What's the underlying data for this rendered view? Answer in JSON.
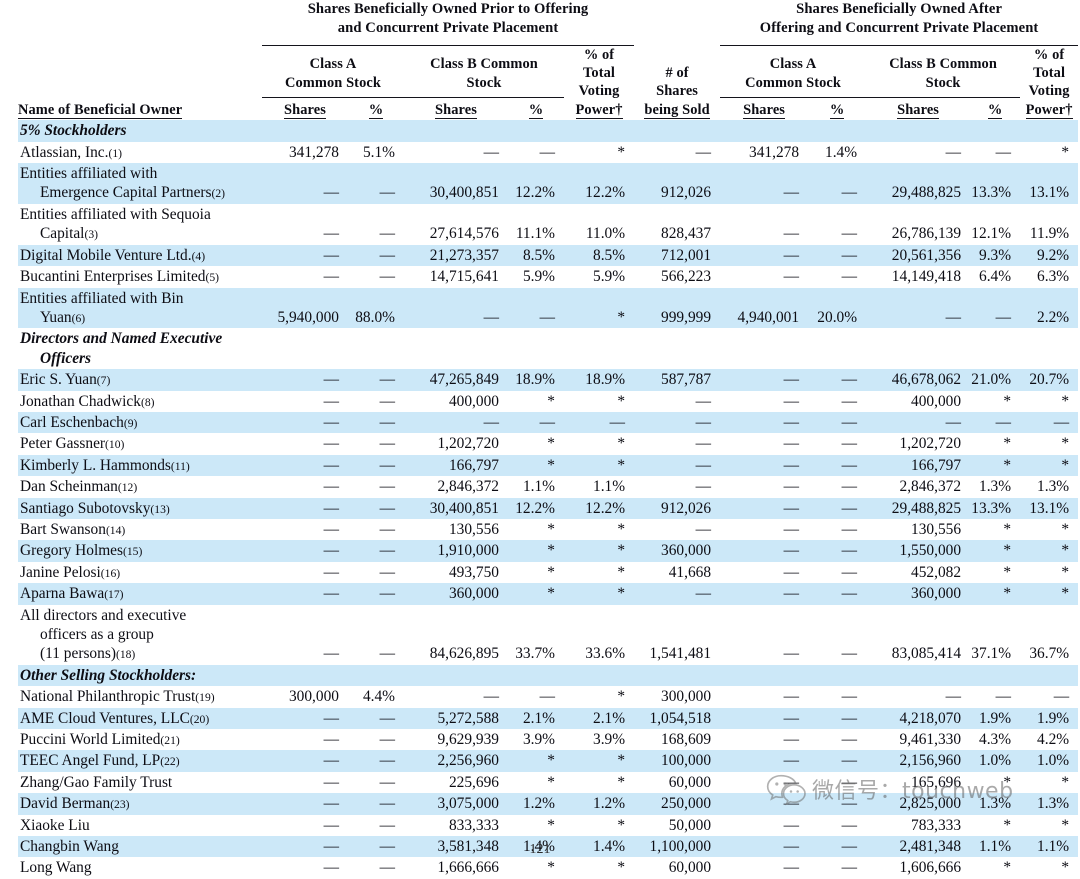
{
  "document": {
    "page_number": "121",
    "watermark_text": "微信号：touchweb",
    "watermark_icon": "wechat-bubble-icon",
    "stripe_color": "#cce8f8",
    "text_color": "#0d0d14"
  },
  "header": {
    "name_column": "Name of Beneficial Owner",
    "group_prior": "Shares Beneficially Owned Prior to Offering and Concurrent Private Placement",
    "group_prior_line1": "Shares Beneficially Owned Prior to Offering",
    "group_prior_line2": "and Concurrent Private Placement",
    "group_after": "Shares Beneficially Owned After Offering and Concurrent Private Placement",
    "group_after_line1": "Shares Beneficially Owned After",
    "group_after_line2": "Offering and Concurrent Private Placement",
    "class_a_line1": "Class A",
    "class_a_line2": "Common Stock",
    "class_b_line1": "Class B Common",
    "class_b_line2": "Stock",
    "shares": "Shares",
    "percent": "%",
    "voting_power_l1": "% of",
    "voting_power_l2": "Total",
    "voting_power_l3": "Voting",
    "voting_power_l4": "Power†",
    "shares_sold_l1": "# of",
    "shares_sold_l2": "Shares",
    "shares_sold_l3": "being Sold"
  },
  "sections": {
    "five_percent": "5% Stockholders",
    "directors": "Directors and Named Executive Officers",
    "directors_line1": "Directors and Named Executive",
    "directors_line2": "Officers",
    "other": "Other Selling Stockholders:"
  },
  "rows": [
    {
      "type": "section",
      "label": "5% Stockholders",
      "shaded": true
    },
    {
      "type": "data",
      "shaded": false,
      "indent": 0,
      "name": "Atlassian, Inc.",
      "note": "(1)",
      "a_shares": "341,278",
      "a_pct": "5.1%",
      "b_shares": "—",
      "b_pct": "—",
      "vp": "*",
      "sold": "—",
      "a2_shares": "341,278",
      "a2_pct": "1.4%",
      "b2_shares": "—",
      "b2_pct": "—",
      "vp2": "*"
    },
    {
      "type": "data",
      "shaded": true,
      "indent": 1,
      "name_line1": "Entities affiliated with",
      "name_line2": "Emergence Capital Partners",
      "note": "(2)",
      "a_shares": "—",
      "a_pct": "—",
      "b_shares": "30,400,851",
      "b_pct": "12.2%",
      "vp": "12.2%",
      "sold": "912,026",
      "a2_shares": "—",
      "a2_pct": "—",
      "b2_shares": "29,488,825",
      "b2_pct": "13.3%",
      "vp2": "13.1%"
    },
    {
      "type": "data",
      "shaded": false,
      "indent": 1,
      "name_line1": "Entities affiliated with Sequoia",
      "name_line2": "Capital",
      "note": "(3)",
      "a_shares": "—",
      "a_pct": "—",
      "b_shares": "27,614,576",
      "b_pct": "11.1%",
      "vp": "11.0%",
      "sold": "828,437",
      "a2_shares": "—",
      "a2_pct": "—",
      "b2_shares": "26,786,139",
      "b2_pct": "12.1%",
      "vp2": "11.9%"
    },
    {
      "type": "data",
      "shaded": true,
      "indent": 0,
      "name": "Digital Mobile Venture Ltd.",
      "note": "(4)",
      "a_shares": "—",
      "a_pct": "—",
      "b_shares": "21,273,357",
      "b_pct": "8.5%",
      "vp": "8.5%",
      "sold": "712,001",
      "a2_shares": "—",
      "a2_pct": "—",
      "b2_shares": "20,561,356",
      "b2_pct": "9.3%",
      "vp2": "9.2%"
    },
    {
      "type": "data",
      "shaded": false,
      "indent": 0,
      "name": "Bucantini Enterprises Limited",
      "note": "(5)",
      "a_shares": "—",
      "a_pct": "—",
      "b_shares": "14,715,641",
      "b_pct": "5.9%",
      "vp": "5.9%",
      "sold": "566,223",
      "a2_shares": "—",
      "a2_pct": "—",
      "b2_shares": "14,149,418",
      "b2_pct": "6.4%",
      "vp2": "6.3%"
    },
    {
      "type": "data",
      "shaded": true,
      "indent": 1,
      "name_line1": "Entities affiliated with Bin",
      "name_line2": "Yuan",
      "note": "(6)",
      "a_shares": "5,940,000",
      "a_pct": "88.0%",
      "b_shares": "—",
      "b_pct": "—",
      "vp": "*",
      "sold": "999,999",
      "a2_shares": "4,940,001",
      "a2_pct": "20.0%",
      "b2_shares": "—",
      "b2_pct": "—",
      "vp2": "2.2%"
    },
    {
      "type": "section2",
      "label_line1": "Directors and Named Executive",
      "label_line2": "Officers",
      "shaded": false
    },
    {
      "type": "data",
      "shaded": true,
      "indent": 0,
      "name": "Eric S. Yuan",
      "note": "(7)",
      "a_shares": "—",
      "a_pct": "—",
      "b_shares": "47,265,849",
      "b_pct": "18.9%",
      "vp": "18.9%",
      "sold": "587,787",
      "a2_shares": "—",
      "a2_pct": "—",
      "b2_shares": "46,678,062",
      "b2_pct": "21.0%",
      "vp2": "20.7%"
    },
    {
      "type": "data",
      "shaded": false,
      "indent": 0,
      "name": "Jonathan Chadwick",
      "note": "(8)",
      "a_shares": "—",
      "a_pct": "—",
      "b_shares": "400,000",
      "b_pct": "*",
      "vp": "*",
      "sold": "—",
      "a2_shares": "—",
      "a2_pct": "—",
      "b2_shares": "400,000",
      "b2_pct": "*",
      "vp2": "*"
    },
    {
      "type": "data",
      "shaded": true,
      "indent": 0,
      "name": "Carl Eschenbach",
      "note": "(9)",
      "a_shares": "—",
      "a_pct": "—",
      "b_shares": "—",
      "b_pct": "—",
      "vp": "—",
      "sold": "—",
      "a2_shares": "—",
      "a2_pct": "—",
      "b2_shares": "—",
      "b2_pct": "—",
      "vp2": "—"
    },
    {
      "type": "data",
      "shaded": false,
      "indent": 0,
      "name": "Peter Gassner",
      "note": "(10)",
      "a_shares": "—",
      "a_pct": "—",
      "b_shares": "1,202,720",
      "b_pct": "*",
      "vp": "*",
      "sold": "—",
      "a2_shares": "—",
      "a2_pct": "—",
      "b2_shares": "1,202,720",
      "b2_pct": "*",
      "vp2": "*"
    },
    {
      "type": "data",
      "shaded": true,
      "indent": 0,
      "name": "Kimberly L. Hammonds",
      "note": "(11)",
      "a_shares": "—",
      "a_pct": "—",
      "b_shares": "166,797",
      "b_pct": "*",
      "vp": "*",
      "sold": "—",
      "a2_shares": "—",
      "a2_pct": "—",
      "b2_shares": "166,797",
      "b2_pct": "*",
      "vp2": "*"
    },
    {
      "type": "data",
      "shaded": false,
      "indent": 0,
      "name": "Dan Scheinman",
      "note": "(12)",
      "a_shares": "—",
      "a_pct": "—",
      "b_shares": "2,846,372",
      "b_pct": "1.1%",
      "vp": "1.1%",
      "sold": "—",
      "a2_shares": "—",
      "a2_pct": "—",
      "b2_shares": "2,846,372",
      "b2_pct": "1.3%",
      "vp2": "1.3%"
    },
    {
      "type": "data",
      "shaded": true,
      "indent": 0,
      "name": "Santiago Subotovsky",
      "note": "(13)",
      "a_shares": "—",
      "a_pct": "—",
      "b_shares": "30,400,851",
      "b_pct": "12.2%",
      "vp": "12.2%",
      "sold": "912,026",
      "a2_shares": "—",
      "a2_pct": "—",
      "b2_shares": "29,488,825",
      "b2_pct": "13.3%",
      "vp2": "13.1%"
    },
    {
      "type": "data",
      "shaded": false,
      "indent": 0,
      "name": "Bart Swanson",
      "note": "(14)",
      "a_shares": "—",
      "a_pct": "—",
      "b_shares": "130,556",
      "b_pct": "*",
      "vp": "*",
      "sold": "—",
      "a2_shares": "—",
      "a2_pct": "—",
      "b2_shares": "130,556",
      "b2_pct": "*",
      "vp2": "*"
    },
    {
      "type": "data",
      "shaded": true,
      "indent": 0,
      "name": "Gregory Holmes",
      "note": "(15)",
      "a_shares": "—",
      "a_pct": "—",
      "b_shares": "1,910,000",
      "b_pct": "*",
      "vp": "*",
      "sold": "360,000",
      "a2_shares": "—",
      "a2_pct": "—",
      "b2_shares": "1,550,000",
      "b2_pct": "*",
      "vp2": "*"
    },
    {
      "type": "data",
      "shaded": false,
      "indent": 0,
      "name": "Janine Pelosi",
      "note": "(16)",
      "a_shares": "—",
      "a_pct": "—",
      "b_shares": "493,750",
      "b_pct": "*",
      "vp": "*",
      "sold": "41,668",
      "a2_shares": "—",
      "a2_pct": "—",
      "b2_shares": "452,082",
      "b2_pct": "*",
      "vp2": "*"
    },
    {
      "type": "data",
      "shaded": true,
      "indent": 0,
      "name": "Aparna Bawa",
      "note": "(17)",
      "a_shares": "—",
      "a_pct": "—",
      "b_shares": "360,000",
      "b_pct": "*",
      "vp": "*",
      "sold": "—",
      "a2_shares": "—",
      "a2_pct": "—",
      "b2_shares": "360,000",
      "b2_pct": "*",
      "vp2": "*"
    },
    {
      "type": "data3",
      "shaded": false,
      "indent": 2,
      "name_line1": "All directors and executive",
      "name_line2": "officers as a group",
      "name_line3": "(11 persons)",
      "note": "(18)",
      "a_shares": "—",
      "a_pct": "—",
      "b_shares": "84,626,895",
      "b_pct": "33.7%",
      "vp": "33.6%",
      "sold": "1,541,481",
      "a2_shares": "—",
      "a2_pct": "—",
      "b2_shares": "83,085,414",
      "b2_pct": "37.1%",
      "vp2": "36.7%"
    },
    {
      "type": "section",
      "label": "Other Selling Stockholders:",
      "shaded": true
    },
    {
      "type": "data",
      "shaded": false,
      "indent": 0,
      "name": "National Philanthropic Trust",
      "note": "(19)",
      "a_shares": "300,000",
      "a_pct": "4.4%",
      "b_shares": "—",
      "b_pct": "—",
      "vp": "*",
      "sold": "300,000",
      "a2_shares": "—",
      "a2_pct": "—",
      "b2_shares": "—",
      "b2_pct": "—",
      "vp2": "—"
    },
    {
      "type": "data",
      "shaded": true,
      "indent": 0,
      "name": "AME Cloud Ventures, LLC",
      "note": "(20)",
      "a_shares": "—",
      "a_pct": "—",
      "b_shares": "5,272,588",
      "b_pct": "2.1%",
      "vp": "2.1%",
      "sold": "1,054,518",
      "a2_shares": "—",
      "a2_pct": "—",
      "b2_shares": "4,218,070",
      "b2_pct": "1.9%",
      "vp2": "1.9%"
    },
    {
      "type": "data",
      "shaded": false,
      "indent": 0,
      "name": "Puccini World Limited",
      "note": "(21)",
      "a_shares": "—",
      "a_pct": "—",
      "b_shares": "9,629,939",
      "b_pct": "3.9%",
      "vp": "3.9%",
      "sold": "168,609",
      "a2_shares": "—",
      "a2_pct": "—",
      "b2_shares": "9,461,330",
      "b2_pct": "4.3%",
      "vp2": "4.2%"
    },
    {
      "type": "data",
      "shaded": true,
      "indent": 0,
      "name": "TEEC Angel Fund, LP",
      "note": "(22)",
      "a_shares": "—",
      "a_pct": "—",
      "b_shares": "2,256,960",
      "b_pct": "*",
      "vp": "*",
      "sold": "100,000",
      "a2_shares": "—",
      "a2_pct": "—",
      "b2_shares": "2,156,960",
      "b2_pct": "1.0%",
      "vp2": "1.0%"
    },
    {
      "type": "data",
      "shaded": false,
      "indent": 0,
      "name": "Zhang/Gao Family Trust",
      "note": "",
      "a_shares": "—",
      "a_pct": "—",
      "b_shares": "225,696",
      "b_pct": "*",
      "vp": "*",
      "sold": "60,000",
      "a2_shares": "—",
      "a2_pct": "—",
      "b2_shares": "165,696",
      "b2_pct": "*",
      "vp2": "*"
    },
    {
      "type": "data",
      "shaded": true,
      "indent": 0,
      "name": "David Berman",
      "note": "(23)",
      "a_shares": "—",
      "a_pct": "—",
      "b_shares": "3,075,000",
      "b_pct": "1.2%",
      "vp": "1.2%",
      "sold": "250,000",
      "a2_shares": "—",
      "a2_pct": "—",
      "b2_shares": "2,825,000",
      "b2_pct": "1.3%",
      "vp2": "1.3%"
    },
    {
      "type": "data",
      "shaded": false,
      "indent": 0,
      "name": "Xiaoke Liu",
      "note": "",
      "a_shares": "—",
      "a_pct": "—",
      "b_shares": "833,333",
      "b_pct": "*",
      "vp": "*",
      "sold": "50,000",
      "a2_shares": "—",
      "a2_pct": "—",
      "b2_shares": "783,333",
      "b2_pct": "*",
      "vp2": "*"
    },
    {
      "type": "data",
      "shaded": true,
      "indent": 0,
      "name": "Changbin Wang",
      "note": "",
      "a_shares": "—",
      "a_pct": "—",
      "b_shares": "3,581,348",
      "b_pct": "1.4%",
      "vp": "1.4%",
      "sold": "1,100,000",
      "a2_shares": "—",
      "a2_pct": "—",
      "b2_shares": "2,481,348",
      "b2_pct": "1.1%",
      "vp2": "1.1%"
    },
    {
      "type": "data",
      "shaded": false,
      "indent": 0,
      "name": "Long Wang",
      "note": "",
      "a_shares": "—",
      "a_pct": "—",
      "b_shares": "1,666,666",
      "b_pct": "*",
      "vp": "*",
      "sold": "60,000",
      "a2_shares": "—",
      "a2_pct": "—",
      "b2_shares": "1,606,666",
      "b2_pct": "*",
      "vp2": "*"
    }
  ]
}
